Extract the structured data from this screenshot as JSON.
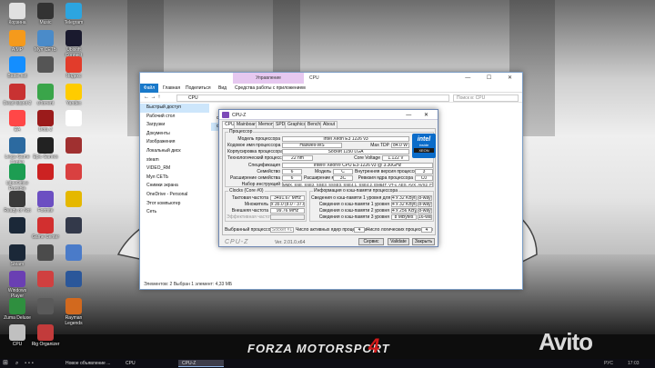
{
  "desktop": {
    "icons": [
      {
        "label": "Корзина",
        "color": "#e0e0e0"
      },
      {
        "label": "Music",
        "color": "#333333"
      },
      {
        "label": "Telegram",
        "color": "#2ca5e0"
      },
      {
        "label": "AIMP",
        "color": "#f59a1c"
      },
      {
        "label": "Мул СЕТЬ",
        "color": "#4a8bc9"
      },
      {
        "label": "Ubisoft Connect",
        "color": "#1a1a2e"
      },
      {
        "label": "Battle.net",
        "color": "#148eff"
      },
      {
        "label": "",
        "color": "#555555"
      },
      {
        "label": "Яндекс",
        "color": "#e23c2b"
      },
      {
        "label": "Dead Island 2",
        "color": "#c83232"
      },
      {
        "label": "uTorrent",
        "color": "#3aa54a"
      },
      {
        "label": "Yandex",
        "color": "#ffcc00"
      },
      {
        "label": "EA",
        "color": "#ff4747"
      },
      {
        "label": "Dota 2",
        "color": "#9b1b1b"
      },
      {
        "label": "",
        "color": "#ffffff"
      },
      {
        "label": "Lesta Game Center",
        "color": "#2c6aa0"
      },
      {
        "label": "Epic Games",
        "color": "#222222"
      },
      {
        "label": "",
        "color": "#a03030"
      },
      {
        "label": "LibreOffice Portable",
        "color": "#1d9d52"
      },
      {
        "label": "",
        "color": "#cc2222"
      },
      {
        "label": "",
        "color": "#d94040"
      },
      {
        "label": "Ready or Not",
        "color": "#3a3a3a"
      },
      {
        "label": "Fortnite",
        "color": "#6c4fc2"
      },
      {
        "label": "",
        "color": "#e5b800"
      },
      {
        "label": "",
        "color": "#1b2838"
      },
      {
        "label": "Game Center",
        "color": "#d22f2f"
      },
      {
        "label": "",
        "color": "#33394a"
      },
      {
        "label": "Steam",
        "color": "#1b2838"
      },
      {
        "label": "",
        "color": "#4b4b4b"
      },
      {
        "label": "",
        "color": "#4a7bc9"
      },
      {
        "label": "Windows Player",
        "color": "#6a3fb3"
      },
      {
        "label": "",
        "color": "#d04040"
      },
      {
        "label": "",
        "color": "#2b579a"
      },
      {
        "label": "Zuma Deluxe",
        "color": "#2f8f3f"
      },
      {
        "label": "",
        "color": "#5a5a5a"
      },
      {
        "label": "Rayman Legends",
        "color": "#d2691e"
      },
      {
        "label": "CPU",
        "color": "#c0c0c0"
      },
      {
        "label": "Rig Organizer",
        "color": "#c23b3b"
      }
    ],
    "banner_text": "FORZA MOTORSPORT",
    "banner_number": "4",
    "watermark": "Avito"
  },
  "explorer": {
    "title": "CPU",
    "manage_tab": "Управление",
    "ribbon": [
      "Файл",
      "Главная",
      "Поделиться",
      "Вид",
      "Средства работы с приложением"
    ],
    "address": "CPU",
    "search_placeholder": "Поиск в: CPU",
    "nav": [
      "Быстрый доступ",
      "Рабочий стол",
      "Загрузки",
      "Документы",
      "Изображения",
      "Локальный диск",
      "steam",
      "VIDEO_RM",
      "Мул СЕТЬ",
      "Снимки экрана",
      "OneDrive - Personal",
      "Этот компьютер",
      "Сеть"
    ],
    "files": [
      "cpuz",
      "cpuz"
    ],
    "status": "Элементов: 2    Выбран 1 элемент: 4,33 МБ"
  },
  "cpuz": {
    "title": "CPU-Z",
    "tabs": [
      "CPU",
      "Mainboard",
      "Memory",
      "SPD",
      "Graphics",
      "Bench",
      "About"
    ],
    "processor_group": "Процессор",
    "labels": {
      "model": "Модель процессора",
      "codename": "Кодовое имя процессора",
      "socket": "Корпусировка процессора",
      "tech": "Технологический процесс",
      "spec": "Спецификация",
      "family": "Семейство",
      "ext_family": "Расширение семейства",
      "instr": "Набор инструкций",
      "maxtdp": "Max TDP",
      "model_n": "Модель",
      "ext_model": "Расширение модели",
      "core_voltage": "Core Voltage",
      "stepping": "Внутренняя версия процессора",
      "revision": "Ревизия ядра процессора"
    },
    "values": {
      "model": "Intel Xeon E3 1226 v3",
      "codename": "Haswell-WS",
      "maxtdp": "84.0 W",
      "socket": "Socket 1150 LGA",
      "tech": "22 nm",
      "core_voltage": "1.122 V",
      "spec": "Intel® Xeon® CPU E3-1226 v3 @ 3.30GHz",
      "family": "6",
      "model_n": "C",
      "stepping": "3",
      "ext_family": "6",
      "ext_model": "3C",
      "revision": "C0",
      "instr": "MMX, SSE, SSE2, SSE3, SSSE3, SSE4.1, SSE4.2, EM64T, VT-x, AES, AVX, AVX2, FMA3"
    },
    "intel_badge": {
      "brand": "intel",
      "line": "XEON",
      "inside": "inside"
    },
    "clocks_group": "Clocks (Core #0)",
    "clocks": [
      {
        "label": "Тактовая частота",
        "value": "3491.67 MHz"
      },
      {
        "label": "Множитель",
        "value": "x 35.0 (8.0 - 37.0)"
      },
      {
        "label": "Внешняя частота",
        "value": "99.76 MHz"
      },
      {
        "label": "Эффективная частота",
        "value": ""
      }
    ],
    "cache_group": "Информация о кэш-памяти процессора",
    "cache": [
      {
        "label": "Сведения о кэш-памяти 1 уровня для данных",
        "size": "4 x 32 KBytes",
        "way": "8-way"
      },
      {
        "label": "Сведения о кэш-памяти 1 уровня",
        "size": "4 x 32 KBytes",
        "way": "8-way"
      },
      {
        "label": "Сведения о кэш-памяти 2 уровня",
        "size": "4 x 256 KBytes",
        "way": "8-way"
      },
      {
        "label": "Сведения о кэш-памяти 3 уровня",
        "size": "8 MBytes",
        "way": "16-way"
      }
    ],
    "selection_label": "Выбранный процессор",
    "selection_value": "Socket #1",
    "cores_label": "Число активных ядер процессора",
    "cores_value": "4",
    "threads_label": "Число логических процессоров",
    "threads_value": "4",
    "brand": "CPU-Z",
    "version": "Ver. 2.01.0.x64",
    "buttons": {
      "service": "Сервис",
      "validate": "Validate",
      "close": "Закрыть"
    }
  },
  "taskbar": {
    "items": [
      {
        "label": "Новое объявление ..."
      },
      {
        "label": "CPU"
      },
      {
        "label": "CPU-Z"
      }
    ],
    "lang": "РУС",
    "time": "17:03"
  }
}
